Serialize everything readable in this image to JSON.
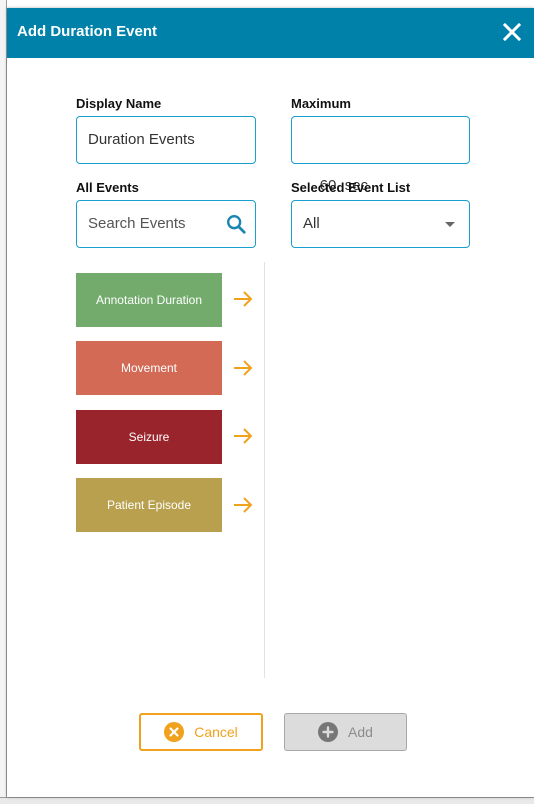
{
  "dialog": {
    "title": "Add Duration Event"
  },
  "form": {
    "display_name_label": "Display Name",
    "display_name_value": "Duration Events",
    "maximum_label": "Maximum",
    "maximum_value": "60  sec",
    "all_events_label": "All Events",
    "search_placeholder": "Search Events",
    "selected_list_label": "Selected Event List",
    "selected_list_value": "All"
  },
  "events": [
    {
      "label": "Annotation Duration",
      "color": "#73ab6d"
    },
    {
      "label": "Movement",
      "color": "#d26a56"
    },
    {
      "label": "Seizure",
      "color": "#9a242c"
    },
    {
      "label": "Patient Episode",
      "color": "#b8a04e"
    }
  ],
  "colors": {
    "header": "#0081aa",
    "field_border": "#1a9fd0",
    "arrow": "#f0a21d",
    "cancel": "#f0a21d"
  },
  "buttons": {
    "cancel_label": "Cancel",
    "add_label": "Add"
  }
}
